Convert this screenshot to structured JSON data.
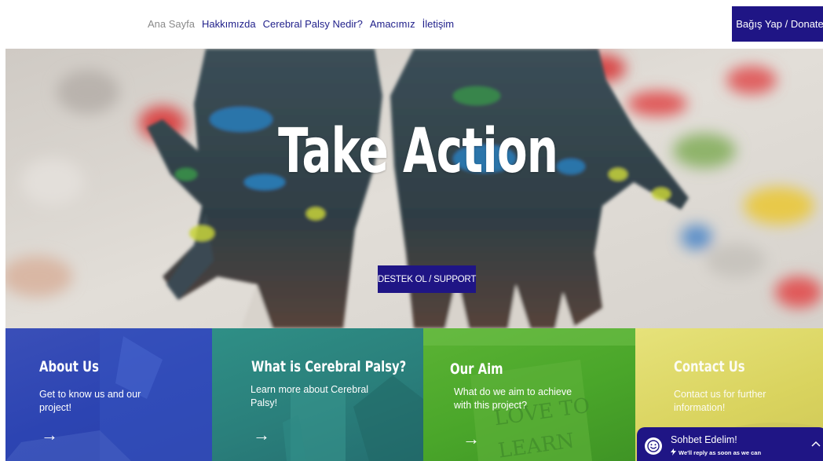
{
  "nav": {
    "items": [
      {
        "label": "Ana Sayfa",
        "current": true
      },
      {
        "label": "Hakkımızda",
        "current": false
      },
      {
        "label": "Cerebral Palsy Nedir?",
        "current": false
      },
      {
        "label": "Amacımız",
        "current": false
      },
      {
        "label": "İletişim",
        "current": false
      }
    ],
    "donate_label": "Bağış Yap / Donate"
  },
  "hero": {
    "title": "Take Action",
    "support_label": "DESTEK OL / SUPPORT"
  },
  "cards": [
    {
      "title": "About Us",
      "text": "Get to know us and our project!",
      "arrow": "→"
    },
    {
      "title": "What is Cerebral Palsy?",
      "text": "Learn more about Cerebral Palsy!",
      "arrow": "→"
    },
    {
      "title": "Our Aim",
      "text": "What do we aim to achieve with this project?",
      "arrow": "→"
    },
    {
      "title": "Contact Us",
      "text": "Contact us for further information!",
      "arrow": ""
    }
  ],
  "card_decor": {
    "sign_text_1": "LOVE TO",
    "sign_text_2": "LEARN"
  },
  "chat": {
    "title": "Sohbet Edelim!",
    "subtitle": "We'll reply as soon as we can",
    "avatar_icon": "smiley-icon",
    "bolt_icon": "bolt-icon",
    "chevron_icon": "chevron-up-icon"
  },
  "colors": {
    "brand_dark_blue": "#1f1585",
    "nav_text": "#1f1f8a",
    "nav_current": "#8a8a8a",
    "card_blue": "#2c44b2",
    "card_teal": "#2a7f7b",
    "card_green": "#4aa62a",
    "card_yellow": "#d9d35e"
  }
}
